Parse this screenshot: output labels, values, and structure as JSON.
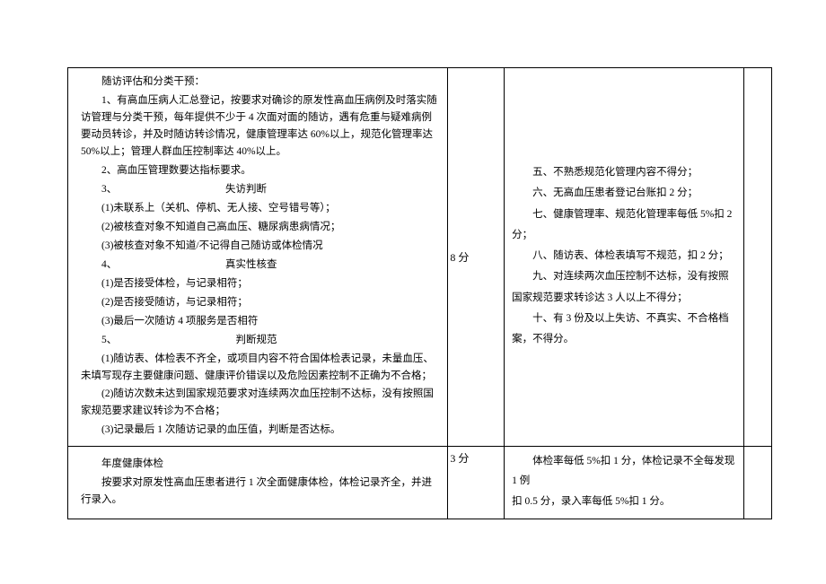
{
  "row1": {
    "left": {
      "title": "随访评估和分类干预：",
      "p1": "1、有高血压病人汇总登记，按要求对确诊的原发性高血压病例及时落实随访管理与分类干预，每年提供不少于 4 次面对面的随访，遇有危重与疑难病例要动员转诊，并及时随访转诊情况，健康管理率达 60%以上，规范化管理率达 50%以上；管理人群血压控制率达 40%以上。",
      "p2": "2、高血压管理数要达指标要求。",
      "p3": "3、　　　　　　　　　　　失访判断",
      "p3a": "(1)未联系上（关机、停机、无人接、空号错号等）；",
      "p3b": "(2)被核查对象不知道自己高血压、糖尿病患病情况；",
      "p3c": "(3)被核查对象不知道/不记得自己随访或体检情况",
      "p4": "4、　　　　　　　　　　　真实性核查",
      "p4a": "(1)是否接受体检，与记录相符；",
      "p4b": "(2)是否接受随访，与记录相符；",
      "p4c": "(3)最后一次随访 4 项服务是否相符",
      "p5": "5、　　　　　　　　　　　　判断规范",
      "p5a": "(1)随访表、体检表不齐全，或项目内容不符合国体检表记录，未量血压、未填写现存主要健康问题、健康评价错误以及危险因素控制不正确为不合格；",
      "p5b": "(2)随访次数未达到国家规范要求对连续两次血压控制不达标，没有按照国家规范要求建议转诊为不合格；",
      "p5c": "(3)记录最后 1 次随访记录的血压值，判断是否达标。"
    },
    "mid": "8 分",
    "right": {
      "r5": "五、不熟悉规范化管理内容不得分；",
      "r6": "六、无高血压患者登记台账扣 2 分；",
      "r7": "七、健康管理率、规范化管理率每低 5%扣 2",
      "r7b": "分；",
      "r8": "八、随访表、体检表填写不规范，扣 2 分；",
      "r9": "九、对连续两次血压控制不达标，没有按照",
      "r9b": "国家规范要求转诊达 3 人以上不得分；",
      "r10": "十、有 3 份及以上失访、不真实、不合格档",
      "r10b": "案，不得分。"
    }
  },
  "row2": {
    "left": {
      "title": "年度健康体检",
      "p1": "按要求对原发性高血压患者进行 1 次全面健康体检，体检记录齐全，并进行录入。"
    },
    "mid": "3 分",
    "right": {
      "r1": "体检率每低 5%扣 1 分，体检记录不全每发现 1 例",
      "r2": "扣 0.5 分，录入率每低 5%扣 1 分。"
    }
  }
}
